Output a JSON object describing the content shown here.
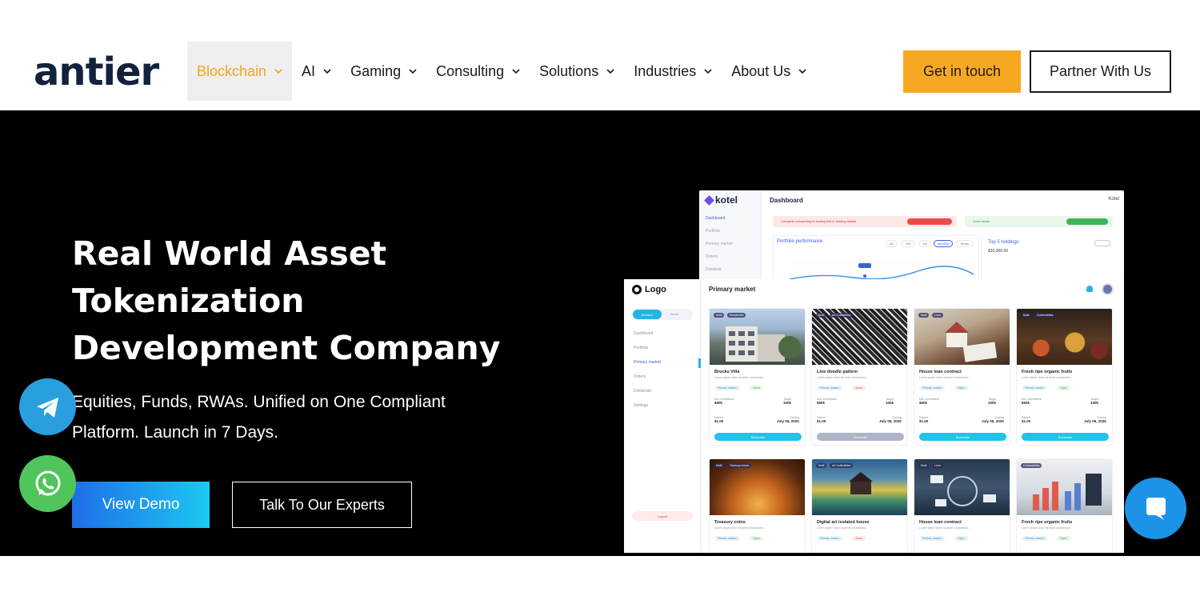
{
  "brand": {
    "name": "antier"
  },
  "nav": {
    "items": [
      {
        "label": "Blockchain",
        "active": true
      },
      {
        "label": "AI",
        "active": false
      },
      {
        "label": "Gaming",
        "active": false
      },
      {
        "label": "Consulting",
        "active": false
      },
      {
        "label": "Solutions",
        "active": false
      },
      {
        "label": "Industries",
        "active": false
      },
      {
        "label": "About Us",
        "active": false
      }
    ],
    "cta_primary": "Get in touch",
    "cta_secondary": "Partner With Us"
  },
  "hero": {
    "title_lines": [
      "Real World Asset",
      "Tokenization",
      "Development Company"
    ],
    "subtitle_lines": [
      "Equities, Funds, RWAs. Unified on One Compliant",
      "Platform. Launch in 7 Days."
    ],
    "btn_demo": "View Demo",
    "btn_experts": "Talk To Our Experts"
  },
  "floating": {
    "telegram": "telegram-icon",
    "whatsapp": "whatsapp-icon",
    "chat": "chat-bubble-icon"
  },
  "mockup_back": {
    "brand": "kotel",
    "title": "Dashboard",
    "corner_brand": "Kotel",
    "sidebar": [
      "Dashboard",
      "Portfolio",
      "Primary market",
      "Orders",
      "Dividend",
      "Settings"
    ],
    "alert_red": "Complete onboarding to trading this in holding assets",
    "alert_green": "Good news!",
    "card_title": "Portfolio performance",
    "ranges": [
      "1D",
      "1W",
      "1M",
      "Monthly",
      "Yearly"
    ],
    "top_title": "Top 5 holdings",
    "top_value": "$10,000.00"
  },
  "mockup_front": {
    "logo": "Logo",
    "toggle_on": "Investor",
    "toggle_off": "Issuer",
    "sidebar": [
      "Dashboard",
      "Portfolio",
      "Primary market",
      "Orders",
      "Dividends",
      "Settings"
    ],
    "logout": "Logout",
    "header": "Primary market",
    "cards": [
      {
        "name": "Brucks Villa",
        "desc": "Lorem ipsum dolor sit amet consectetur...",
        "tag": "Residential",
        "status": "Close",
        "min": "$50k",
        "target": "100k",
        "raised": "$1.00",
        "date": "July 06, 2025",
        "action": "Subscribe"
      },
      {
        "name": "Line doodle pattern",
        "desc": "Lorem ipsum dolor sit amet consectetur...",
        "tag": "Art Collectibles",
        "status": "Close",
        "min": "$50k",
        "target": "100k",
        "raised": "$1.00",
        "date": "July 06, 2025",
        "action": "Subscribe"
      },
      {
        "name": "House loan contract",
        "desc": "Lorem ipsum dolor sit amet consectetur...",
        "tag": "Loan",
        "status": "Open",
        "min": "$50k",
        "target": "100k",
        "raised": "$1.00",
        "date": "July 06, 2025",
        "action": "Subscribe"
      },
      {
        "name": "Fresh ripe organic fruits",
        "desc": "Lorem ipsum dolor sit amet consectetur...",
        "tag": "Commodities",
        "status": "Open",
        "min": "$50k",
        "target": "100k",
        "raised": "$1.00",
        "date": "July 06, 2025",
        "action": "Subscribe"
      },
      {
        "name": "Treasury coins",
        "desc": "Lorem ipsum dolor sit amet consectetur...",
        "tag": "Treasury bonds",
        "status": "Open",
        "min": "",
        "target": "",
        "raised": "",
        "date": "",
        "action": ""
      },
      {
        "name": "Digital art isolated house",
        "desc": "Lorem ipsum dolor sit amet consectetur...",
        "tag": "Art Collectibles",
        "status": "Close",
        "min": "",
        "target": "",
        "raised": "",
        "date": "",
        "action": ""
      },
      {
        "name": "House loan contract",
        "desc": "Lorem ipsum dolor sit amet consectetur...",
        "tag": "Loan",
        "status": "Open",
        "min": "",
        "target": "",
        "raised": "",
        "date": "",
        "action": ""
      },
      {
        "name": "Fresh ripe organic fruits",
        "desc": "Lorem ipsum dolor sit amet consectetur...",
        "tag": "Commodities",
        "status": "Open",
        "min": "",
        "target": "",
        "raised": "",
        "date": "",
        "action": ""
      }
    ],
    "labels": {
      "pm": "Primary market",
      "min": "Min. investment",
      "target": "Target",
      "raised": "Raised",
      "date": "Closing"
    }
  },
  "colors": {
    "accent": "#f7a823",
    "hero_bg": "#000000",
    "demo_from": "#1f6ee8",
    "demo_to": "#1cc8f2",
    "logo": "#14213d"
  }
}
